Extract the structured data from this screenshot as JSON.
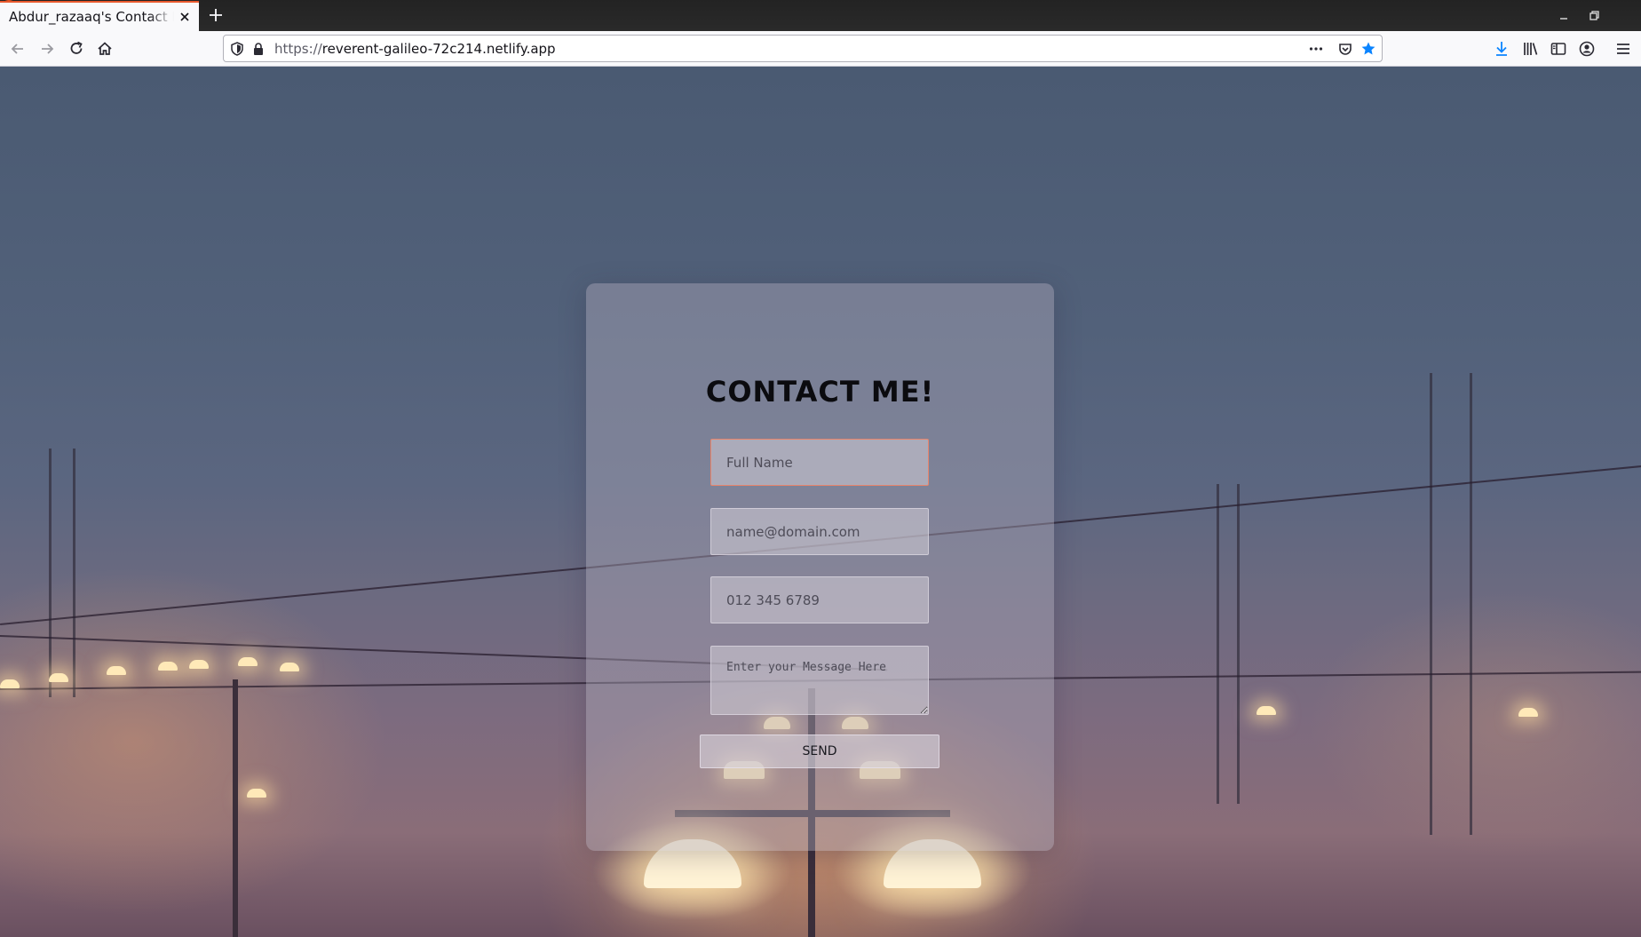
{
  "browser": {
    "tab_title": "Abdur_razaaq's Contact Form",
    "url_protocol": "https://",
    "url_host": "reverent-galileo-72c214.netlify.app"
  },
  "form": {
    "title": "CONTACT ME!",
    "name_placeholder": "Full Name",
    "email_placeholder": "name@domain.com",
    "phone_placeholder": "012 345 6789",
    "message_placeholder": "Enter your Message Here",
    "send_label": "SEND"
  },
  "colors": {
    "tab_accent": "#e8582d",
    "bookmark_star": "#0a84ff",
    "download_arrow": "#0a84ff",
    "window_close": "#e95420",
    "focus_border": "#e8846b"
  }
}
